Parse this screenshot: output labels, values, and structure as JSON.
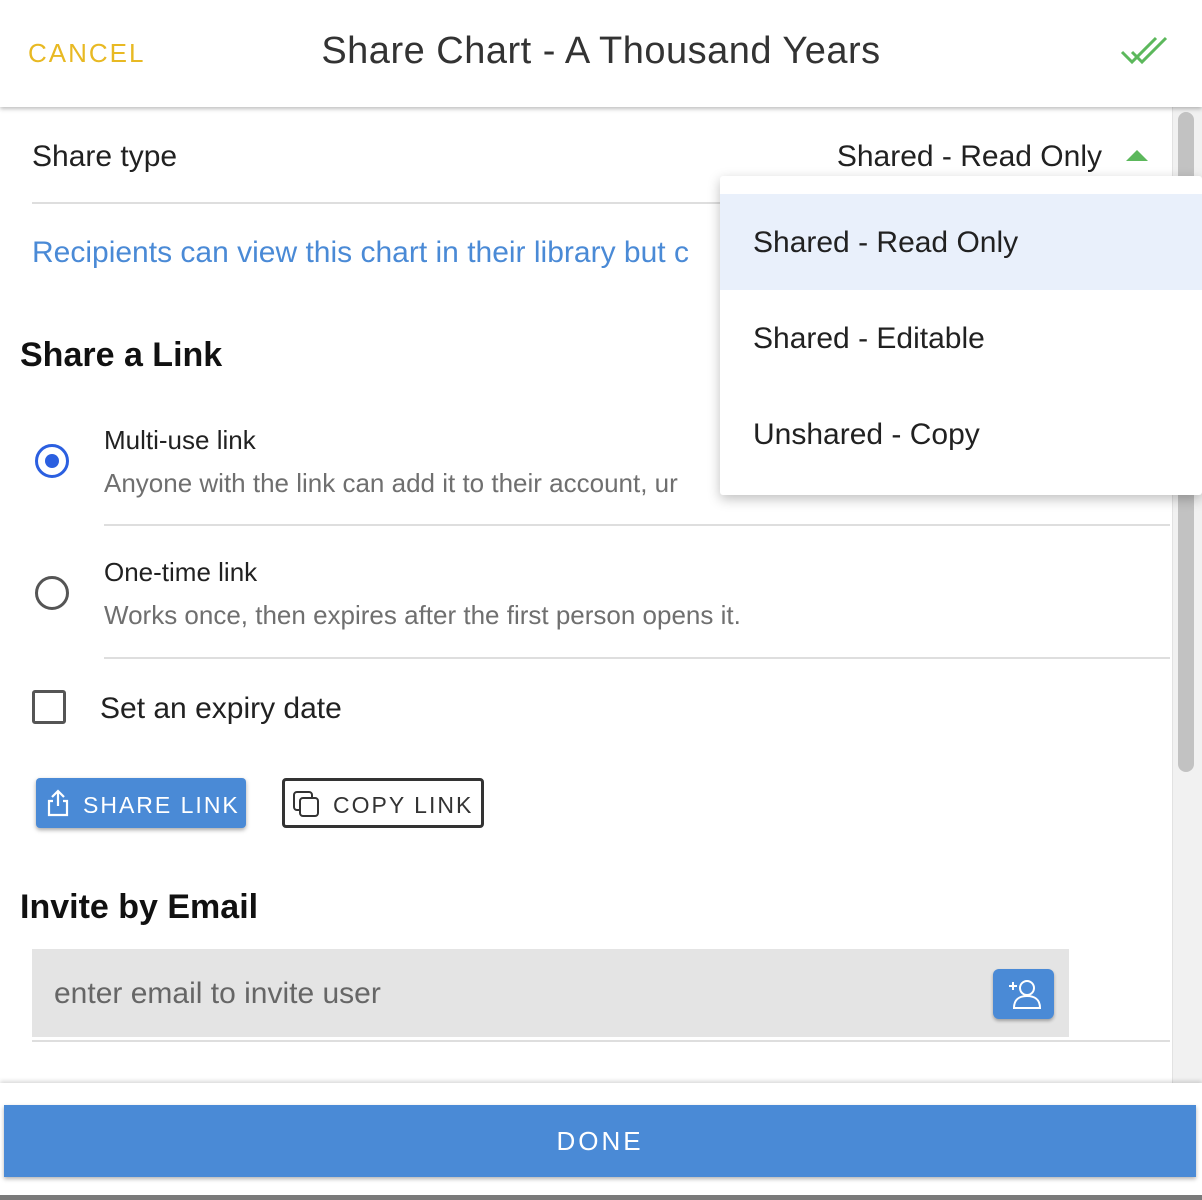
{
  "header": {
    "cancel_label": "CANCEL",
    "title": "Share Chart - A Thousand Years",
    "confirm_icon": "double-check-icon"
  },
  "share_type": {
    "label": "Share type",
    "value": "Shared - Read Only",
    "description": "Recipients can view this chart in their library but c"
  },
  "dropdown": {
    "options": [
      "Shared - Read Only",
      "Shared - Editable",
      "Unshared - Copy"
    ],
    "selected_index": 0
  },
  "share_link": {
    "heading": "Share a Link",
    "options": [
      {
        "title": "Multi-use link",
        "description": "Anyone with the link can add it to their account, ur",
        "checked": true
      },
      {
        "title": "One-time link",
        "description": "Works once, then expires after the first person opens it.",
        "checked": false
      }
    ],
    "expiry_label": "Set an expiry date",
    "expiry_checked": false,
    "share_button_label": "SHARE LINK",
    "copy_button_label": "COPY LINK"
  },
  "invite": {
    "heading": "Invite by Email",
    "placeholder": "enter email to invite user",
    "value": ""
  },
  "footer": {
    "done_label": "DONE"
  },
  "colors": {
    "accent": "#4a8ad6",
    "cancel": "#e8b923",
    "check": "#5cb85c",
    "radio": "#2b5fe0"
  }
}
